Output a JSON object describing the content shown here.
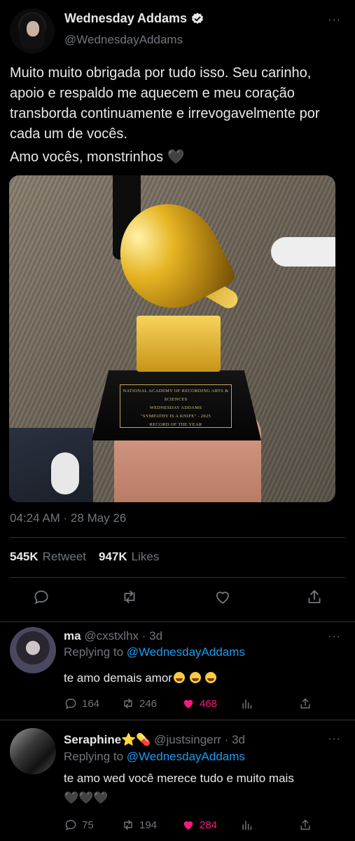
{
  "tweet": {
    "name": "Wednesday Addams",
    "handle": "@WednesdayAddams",
    "more": "···",
    "text": "Muito muito obrigada por tudo isso. Seu carinho, apoio e respaldo me aquecem e meu coração transborda continuamente e irrevogavelmente por cada um de vocês.",
    "text2": "Amo vocês, monstrinhos 🖤",
    "photo_plaque": [
      "NATIONAL ACADEMY OF RECORDING ARTS & SCIENCES",
      "WEDNESDAY ADDAMS",
      "\"SYMPATHY IS A KNIFE\" - 2025",
      "RECORD OF THE YEAR"
    ],
    "timestamp": "04:24 AM · 28 May 26",
    "retweets_count": "545K",
    "retweets_label": "Retweet",
    "likes_count": "947K",
    "likes_label": "Likes",
    "icons": [
      "reply-icon",
      "retweet-icon",
      "like-icon",
      "share-icon"
    ]
  },
  "replies": [
    {
      "name": "ma",
      "handle": "@cxstxlhx",
      "age": "· 3d",
      "replying_prefix": "Replying to",
      "replying_to": "@WednesdayAddams",
      "text": "te amo demais amor",
      "emoji_count": 3,
      "reply_count": "164",
      "retweet_count": "246",
      "like_count": "468",
      "liked": true
    },
    {
      "name": "Seraphine⭐💊",
      "handle": "@justsingerr",
      "age": "· 3d",
      "replying_prefix": "Replying to",
      "replying_to": "@WednesdayAddams",
      "text": "te amo wed você merece tudo e muito mais",
      "text2": "🖤🖤🖤",
      "reply_count": "75",
      "retweet_count": "194",
      "like_count": "284",
      "liked": true
    }
  ],
  "colors": {
    "background": "#000000",
    "text": "#e7e9ea",
    "muted": "#71767b",
    "link": "#1d9bf0",
    "like": "#f91880",
    "divider": "#2f3336"
  }
}
